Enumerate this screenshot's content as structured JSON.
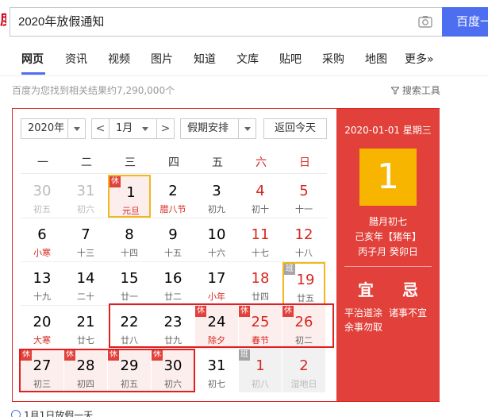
{
  "search": {
    "query": "2020年放假通知",
    "button": "百度一下"
  },
  "tabs": [
    "网页",
    "资讯",
    "视频",
    "图片",
    "知道",
    "文库",
    "贴吧",
    "采购",
    "地图",
    "更多»"
  ],
  "result_count": "百度为您找到相关结果约7,290,000个",
  "search_tools": "搜索工具",
  "calendar": {
    "year": "2020年",
    "month": "1月",
    "prev": "<",
    "next": ">",
    "holiday_select": "假期安排",
    "today_button": "返回今天",
    "weekdays": [
      "一",
      "二",
      "三",
      "四",
      "五",
      "六",
      "日"
    ],
    "badge_rest": "休",
    "badge_work": "班",
    "rows": [
      [
        {
          "n": "30",
          "l": "初五"
        },
        {
          "n": "31",
          "l": "初六"
        },
        {
          "n": "1",
          "l": "元旦"
        },
        {
          "n": "2",
          "l": "腊八节"
        },
        {
          "n": "3",
          "l": "初九"
        },
        {
          "n": "4",
          "l": "初十"
        },
        {
          "n": "5",
          "l": "十一"
        }
      ],
      [
        {
          "n": "6",
          "l": "小寒"
        },
        {
          "n": "7",
          "l": "十三"
        },
        {
          "n": "8",
          "l": "十四"
        },
        {
          "n": "9",
          "l": "十五"
        },
        {
          "n": "10",
          "l": "十六"
        },
        {
          "n": "11",
          "l": "十七"
        },
        {
          "n": "12",
          "l": "十八"
        }
      ],
      [
        {
          "n": "13",
          "l": "十九"
        },
        {
          "n": "14",
          "l": "二十"
        },
        {
          "n": "15",
          "l": "廿一"
        },
        {
          "n": "16",
          "l": "廿二"
        },
        {
          "n": "17",
          "l": "小年"
        },
        {
          "n": "18",
          "l": "廿四"
        },
        {
          "n": "19",
          "l": "廿五"
        }
      ],
      [
        {
          "n": "20",
          "l": "大寒"
        },
        {
          "n": "21",
          "l": "廿七"
        },
        {
          "n": "22",
          "l": "廿八"
        },
        {
          "n": "23",
          "l": "廿九"
        },
        {
          "n": "24",
          "l": "除夕"
        },
        {
          "n": "25",
          "l": "春节"
        },
        {
          "n": "26",
          "l": "初二"
        }
      ],
      [
        {
          "n": "27",
          "l": "初三"
        },
        {
          "n": "28",
          "l": "初四"
        },
        {
          "n": "29",
          "l": "初五"
        },
        {
          "n": "30",
          "l": "初六"
        },
        {
          "n": "31",
          "l": "初七"
        },
        {
          "n": "1",
          "l": "初八"
        },
        {
          "n": "2",
          "l": "湿地日"
        }
      ]
    ],
    "side": {
      "date": "2020-01-01 星期三",
      "day": "1",
      "lunar": "腊月初七",
      "ganzhi_year": "己亥年【猪年】",
      "ganzhi_day": "丙子月 癸卯日",
      "yi": "宜",
      "ji": "忌",
      "yi_text": "平治道涂",
      "ji_text": "诸事不宜",
      "extra": "余事勿取"
    }
  },
  "bottom_tip": "1月1日放假一天",
  "colors": {
    "accent": "#4e6ef2",
    "red": "#e1413a",
    "gold": "#f7b500"
  }
}
